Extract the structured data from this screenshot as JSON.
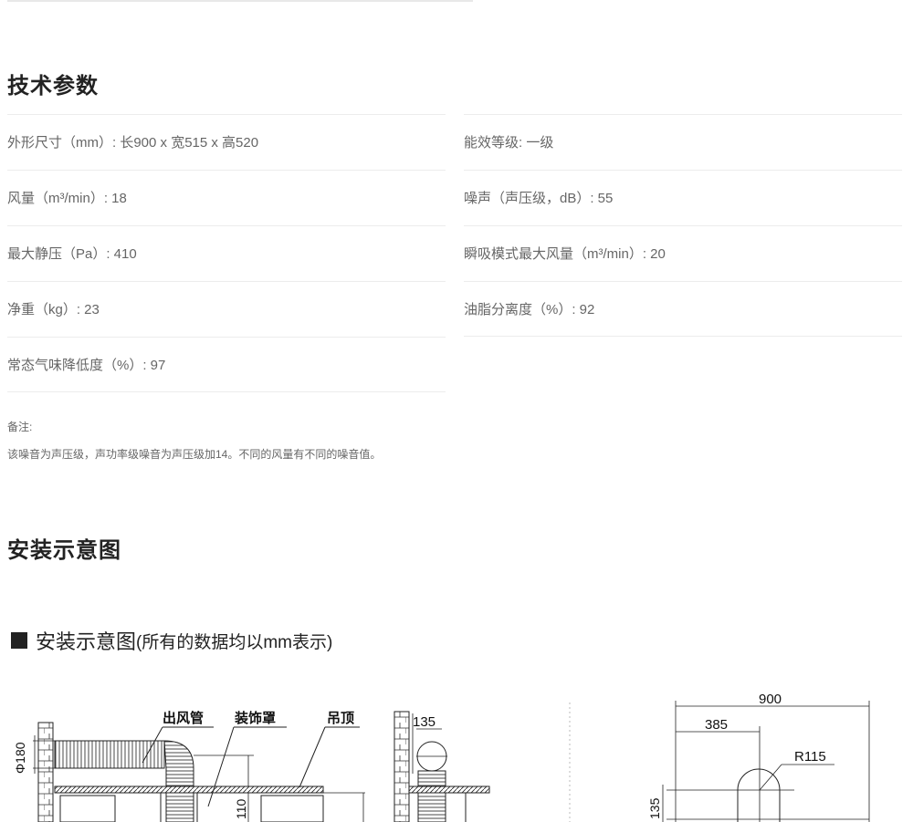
{
  "spec": {
    "title": "技术参数",
    "left": [
      "外形尺寸（mm）: 长900 x 宽515 x 高520",
      "风量（m³/min）: 18",
      "最大静压（Pa）: 410",
      "净重（kg）: 23",
      "常态气味降低度（%）: 97"
    ],
    "right": [
      "能效等级: 一级",
      "噪声（声压级，dB）: 55",
      "瞬吸模式最大风量（m³/min）: 20",
      "油脂分离度（%）: 92"
    ],
    "note_label": "备注:",
    "note_text": "该噪音为声压级，声功率级噪音为声压级加14。不同的风量有不同的噪音值。"
  },
  "install": {
    "title": "安装示意图",
    "heading": "安装示意图",
    "heading_sub": "(所有的数据均以mm表示)",
    "labels": {
      "outlet_pipe": "出风管",
      "decor_cover": "装饰罩",
      "ceiling": "吊顶",
      "phi": "Φ180",
      "dim_110": "110",
      "dim_135_top": "135",
      "dim_900": "900",
      "dim_385": "385",
      "r115": "R115",
      "dim_135_side": "135"
    }
  },
  "colors": {
    "title": "#222222",
    "text": "#666666",
    "rule": "#ececec",
    "drawing": "#111111"
  }
}
